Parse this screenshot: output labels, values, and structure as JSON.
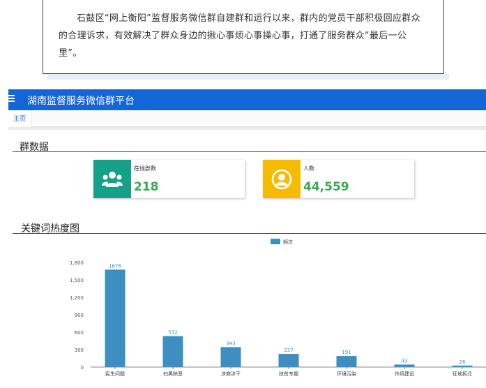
{
  "article": {
    "quote_line1": "石鼓区“网上衡阳”监督服务微信群自建群和运行以来，群内的党员干部积极回应群众的合理诉求，有效解决了群众身边的揪心事烦心事操心事，打通了服务群众“最后一公里”。"
  },
  "app": {
    "title": "湖南监督服务微信群平台",
    "tab_home": "主页",
    "section_group_data": "群数据",
    "section_keyword_heat": "关键词热度图"
  },
  "stats": {
    "online_groups_label": "在线群数",
    "online_groups_value": "218",
    "people_label": "人数",
    "people_value": "44,559"
  },
  "colors": {
    "topbar": "#1565d8",
    "card_teal": "#15a08a",
    "card_amber": "#f5bb00",
    "value_green": "#3aa84e",
    "bar": "#3d8fc2"
  },
  "icons": {
    "menu": "menu-icon",
    "groups": "group-users-icon",
    "person": "person-icon"
  },
  "chart_data": {
    "type": "bar",
    "legend": "频次",
    "categories": [
      "民生问题",
      "扫黑除恶",
      "涉商涉干",
      "扶贫专题",
      "环境污染",
      "作风建设",
      "征地拆迁"
    ],
    "values": [
      1676,
      532,
      343,
      227,
      191,
      43,
      26
    ],
    "ylim": [
      0,
      1800
    ],
    "yticks": [
      "0",
      "300",
      "600",
      "900",
      "1,200",
      "1,500",
      "1,800"
    ],
    "ytick_values": [
      0,
      300,
      600,
      900,
      1200,
      1500,
      1800
    ],
    "grid": false,
    "legend_position": "top-center"
  }
}
